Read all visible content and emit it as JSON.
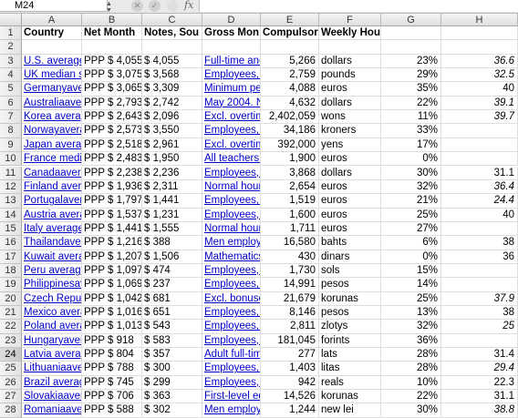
{
  "formula_bar": {
    "name_box": "M24",
    "cancel_icon": "✕",
    "confirm_icon": "✓",
    "fx_label": "fx",
    "formula": ""
  },
  "colors": {
    "link": "#0000cc",
    "header_bg": "#e4e4e4",
    "grid": "#dedede"
  },
  "active_row": "24",
  "columns": [
    "A",
    "B",
    "C",
    "D",
    "E",
    "F",
    "G",
    "H"
  ],
  "header_row": {
    "row": "1",
    "cells": [
      "Country",
      "Net Month",
      "Notes, Sou",
      "Gross Mon",
      "Compulsor",
      "Weekly Hours",
      "",
      ""
    ]
  },
  "empty_row": "2",
  "rows": [
    {
      "row": "3",
      "cells": [
        "U.S. average",
        "PPP $ 4,055",
        "$ 4,055",
        "Full-time and",
        "5,266",
        "dollars",
        "23%",
        "36.6"
      ]
    },
    {
      "row": "4",
      "cells": [
        "UK median s",
        "PPP $ 3,075",
        "$ 3,568",
        "Employees, 2",
        "2,759",
        "pounds",
        "29%",
        "32.5"
      ]
    },
    {
      "row": "5",
      "cells": [
        "Germanyave",
        "PPP $ 3,065",
        "$ 3,309",
        "Minimum pe",
        "4,088",
        "euros",
        "35%",
        "40"
      ]
    },
    {
      "row": "6",
      "cells": [
        "Australiaave",
        "PPP $ 2,793",
        "$ 2,742",
        "May 2004. N",
        "4,632",
        "dollars",
        "22%",
        "39.1"
      ]
    },
    {
      "row": "7",
      "cells": [
        "Korea averag",
        "PPP $ 2,643",
        "$ 2,096",
        "Excl. overtim",
        "2,402,059",
        "wons",
        "11%",
        "39.7"
      ]
    },
    {
      "row": "8",
      "cells": [
        "Norwayavera",
        "PPP $ 2,573",
        "$ 3,550",
        "Employees, 2",
        "34,186",
        "kroners",
        "33%",
        ""
      ]
    },
    {
      "row": "9",
      "cells": [
        "Japan averag",
        "PPP $ 2,518",
        "$ 2,961",
        "Excl. overtim",
        "392,000",
        "yens",
        "17%",
        ""
      ]
    },
    {
      "row": "10",
      "cells": [
        "France media",
        "PPP $ 2,483",
        "$ 1,950",
        "All teachers a",
        "1,900",
        "euros",
        "0%",
        ""
      ]
    },
    {
      "row": "11",
      "cells": [
        "Canadaavera",
        "PPP $ 2,238",
        "$ 2,236",
        "Employees, 2",
        "3,868",
        "dollars",
        "30%",
        "31.1"
      ]
    },
    {
      "row": "12",
      "cells": [
        "Finland aver",
        "PPP $ 1,936",
        "$ 2,311",
        "Normal hour",
        "2,654",
        "euros",
        "32%",
        "36.4"
      ]
    },
    {
      "row": "13",
      "cells": [
        "Portugalaver",
        "PPP $ 1,797",
        "$ 1,441",
        "Employees, 2",
        "1,519",
        "euros",
        "21%",
        "24.4"
      ]
    },
    {
      "row": "14",
      "cells": [
        "Austria avera",
        "PPP $ 1,537",
        "$ 1,231",
        "Employees, 2",
        "1,600",
        "euros",
        "25%",
        "40"
      ]
    },
    {
      "row": "15",
      "cells": [
        "Italy average",
        "PPP $ 1,441",
        "$ 1,555",
        "Normal hour",
        "1,711",
        "euros",
        "27%",
        ""
      ]
    },
    {
      "row": "16",
      "cells": [
        "Thailandaver",
        "PPP $ 1,216",
        "$ 388",
        "Men employ",
        "16,580",
        "bahts",
        "6%",
        "38"
      ]
    },
    {
      "row": "17",
      "cells": [
        "Kuwait avera",
        "PPP $ 1,207",
        "$ 1,506",
        "Mathematics",
        "430",
        "dinars",
        "0%",
        "36"
      ]
    },
    {
      "row": "18",
      "cells": [
        "Peru average",
        "PPP $ 1,097",
        "$ 474",
        "Employees, J",
        "1,730",
        "sols",
        "15%",
        ""
      ]
    },
    {
      "row": "19",
      "cells": [
        "Philippinesav",
        "PPP $ 1,069",
        "$ 237",
        "Employees, 2",
        "14,991",
        "pesos",
        "14%",
        ""
      ]
    },
    {
      "row": "20",
      "cells": [
        "Czech Repub",
        "PPP $ 1,042",
        "$ 681",
        "Excl. bonuse",
        "21,679",
        "korunas",
        "25%",
        "37.9"
      ]
    },
    {
      "row": "21",
      "cells": [
        "Mexico avera",
        "PPP $ 1,016",
        "$ 651",
        "Employees, 2",
        "8,146",
        "pesos",
        "13%",
        "38"
      ]
    },
    {
      "row": "22",
      "cells": [
        "Poland avera",
        "PPP $ 1,013",
        "$ 543",
        "Employees, i",
        "2,811",
        "zlotys",
        "32%",
        "25"
      ]
    },
    {
      "row": "23",
      "cells": [
        "Hungaryaver",
        "PPP $ 918",
        "$ 583",
        "Employees, N",
        "181,045",
        "forints",
        "36%",
        ""
      ]
    },
    {
      "row": "24",
      "cells": [
        "Latvia averag",
        "PPP $ 804",
        "$ 357",
        "Adult full-tim",
        "277",
        "lats",
        "28%",
        "31.4"
      ]
    },
    {
      "row": "25",
      "cells": [
        "Lithuaniaave",
        "PPP $ 788",
        "$ 300",
        "Employees, 2",
        "1,403",
        "litas",
        "28%",
        "29.4"
      ]
    },
    {
      "row": "26",
      "cells": [
        "Brazil averag",
        "PPP $ 745",
        "$ 299",
        "Employees, D",
        "942",
        "reals",
        "10%",
        "22.3"
      ]
    },
    {
      "row": "27",
      "cells": [
        "Slovakiaaver",
        "PPP $ 706",
        "$ 363",
        "First-level ed",
        "14,526",
        "korunas",
        "22%",
        "31.1"
      ]
    },
    {
      "row": "28",
      "cells": [
        "Romaniaaver",
        "PPP $ 588",
        "$ 302",
        "Men employ",
        "1,244",
        "new lei",
        "30%",
        "38.8"
      ]
    }
  ]
}
